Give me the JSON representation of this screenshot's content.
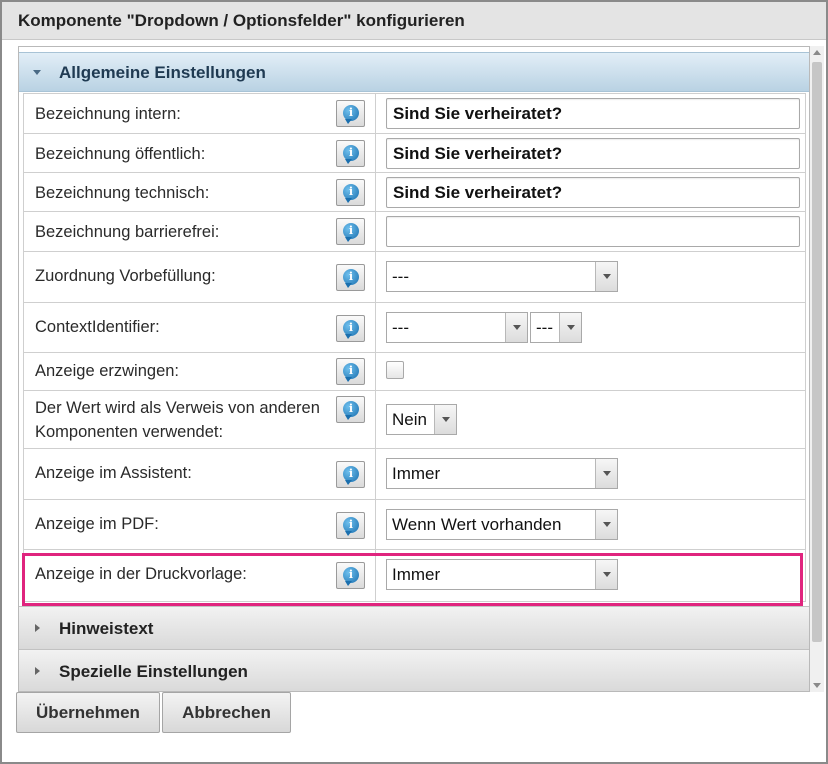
{
  "dialog": {
    "title": "Komponente \"Dropdown / Optionsfelder\" konfigurieren"
  },
  "sections": {
    "general": "Allgemeine Einstellungen",
    "hint": "Hinweistext",
    "special": "Spezielle Einstellungen"
  },
  "fields": {
    "internal_name": {
      "label": "Bezeichnung intern:",
      "value": "Sind Sie verheiratet?"
    },
    "public_name": {
      "label": "Bezeichnung öffentlich:",
      "value": "Sind Sie verheiratet?"
    },
    "technical_name": {
      "label": "Bezeichnung technisch:",
      "value": "Sind Sie verheiratet?"
    },
    "accessible_name": {
      "label": "Bezeichnung barrierefrei:",
      "value": ""
    },
    "prefill_mapping": {
      "label": "Zuordnung Vorbefüllung:",
      "value": "---"
    },
    "context_identifier": {
      "label": "ContextIdentifier:",
      "value1": "---",
      "value2": "---"
    },
    "force_display": {
      "label": "Anzeige erzwingen:",
      "checked": false
    },
    "used_as_reference": {
      "label": "Der Wert wird als Verweis von anderen Komponenten verwendet:",
      "value": "Nein"
    },
    "display_assistant": {
      "label": "Anzeige im Assistent:",
      "value": "Immer"
    },
    "display_pdf": {
      "label": "Anzeige im PDF:",
      "value": "Wenn Wert vorhanden"
    },
    "display_print": {
      "label": "Anzeige in der Druckvorlage:",
      "value": "Immer"
    }
  },
  "buttons": {
    "apply": "Übernehmen",
    "cancel": "Abbrechen"
  },
  "colors": {
    "highlight": "#e0247e",
    "section_open": "#b9d2e3",
    "info_icon": "#1a6fae"
  },
  "icons": {
    "info": "info-bubble-icon",
    "expand": "triangle-down-icon",
    "collapse": "triangle-right-icon"
  }
}
